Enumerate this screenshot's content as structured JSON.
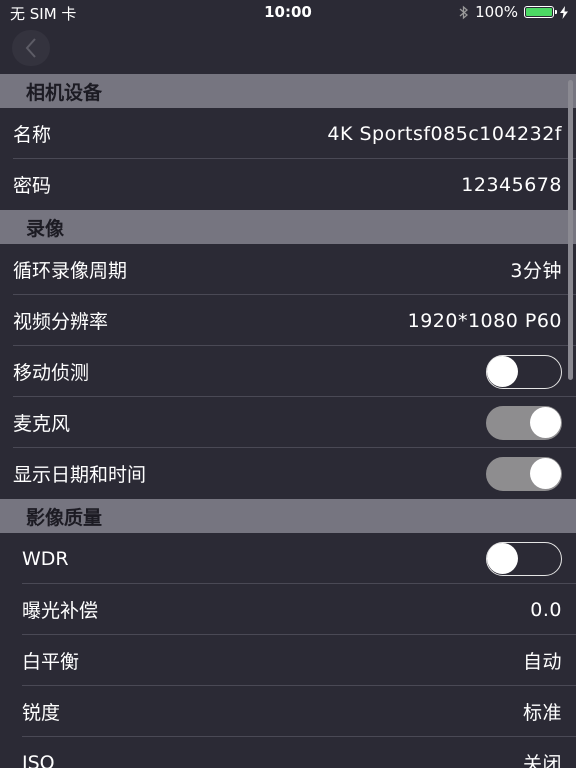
{
  "status_bar": {
    "carrier": "无 SIM 卡",
    "time": "10:00",
    "battery_percent": "100%"
  },
  "sections": [
    {
      "title": "相机设备",
      "rows": [
        {
          "label": "名称",
          "value": "4K Sportsf085c104232f"
        },
        {
          "label": "密码",
          "value": "12345678"
        }
      ]
    },
    {
      "title": "录像",
      "rows": [
        {
          "label": "循环录像周期",
          "value": "3分钟"
        },
        {
          "label": "视频分辨率",
          "value": "1920*1080 P60"
        },
        {
          "label": "移动侦测",
          "toggle": false
        },
        {
          "label": "麦克风",
          "toggle": true
        },
        {
          "label": "显示日期和时间",
          "toggle": true
        }
      ]
    },
    {
      "title": "影像质量",
      "rows": [
        {
          "label": "WDR",
          "toggle": false
        },
        {
          "label": "曝光补偿",
          "value": "0.0"
        },
        {
          "label": "白平衡",
          "value": "自动"
        },
        {
          "label": "锐度",
          "value": "标准"
        },
        {
          "label": "ISO",
          "value": "关闭"
        }
      ]
    }
  ],
  "colors": {
    "background": "#2b2a35",
    "section_header": "#767580",
    "toggle_on": "#8e8d8f",
    "battery": "#4cd964"
  }
}
